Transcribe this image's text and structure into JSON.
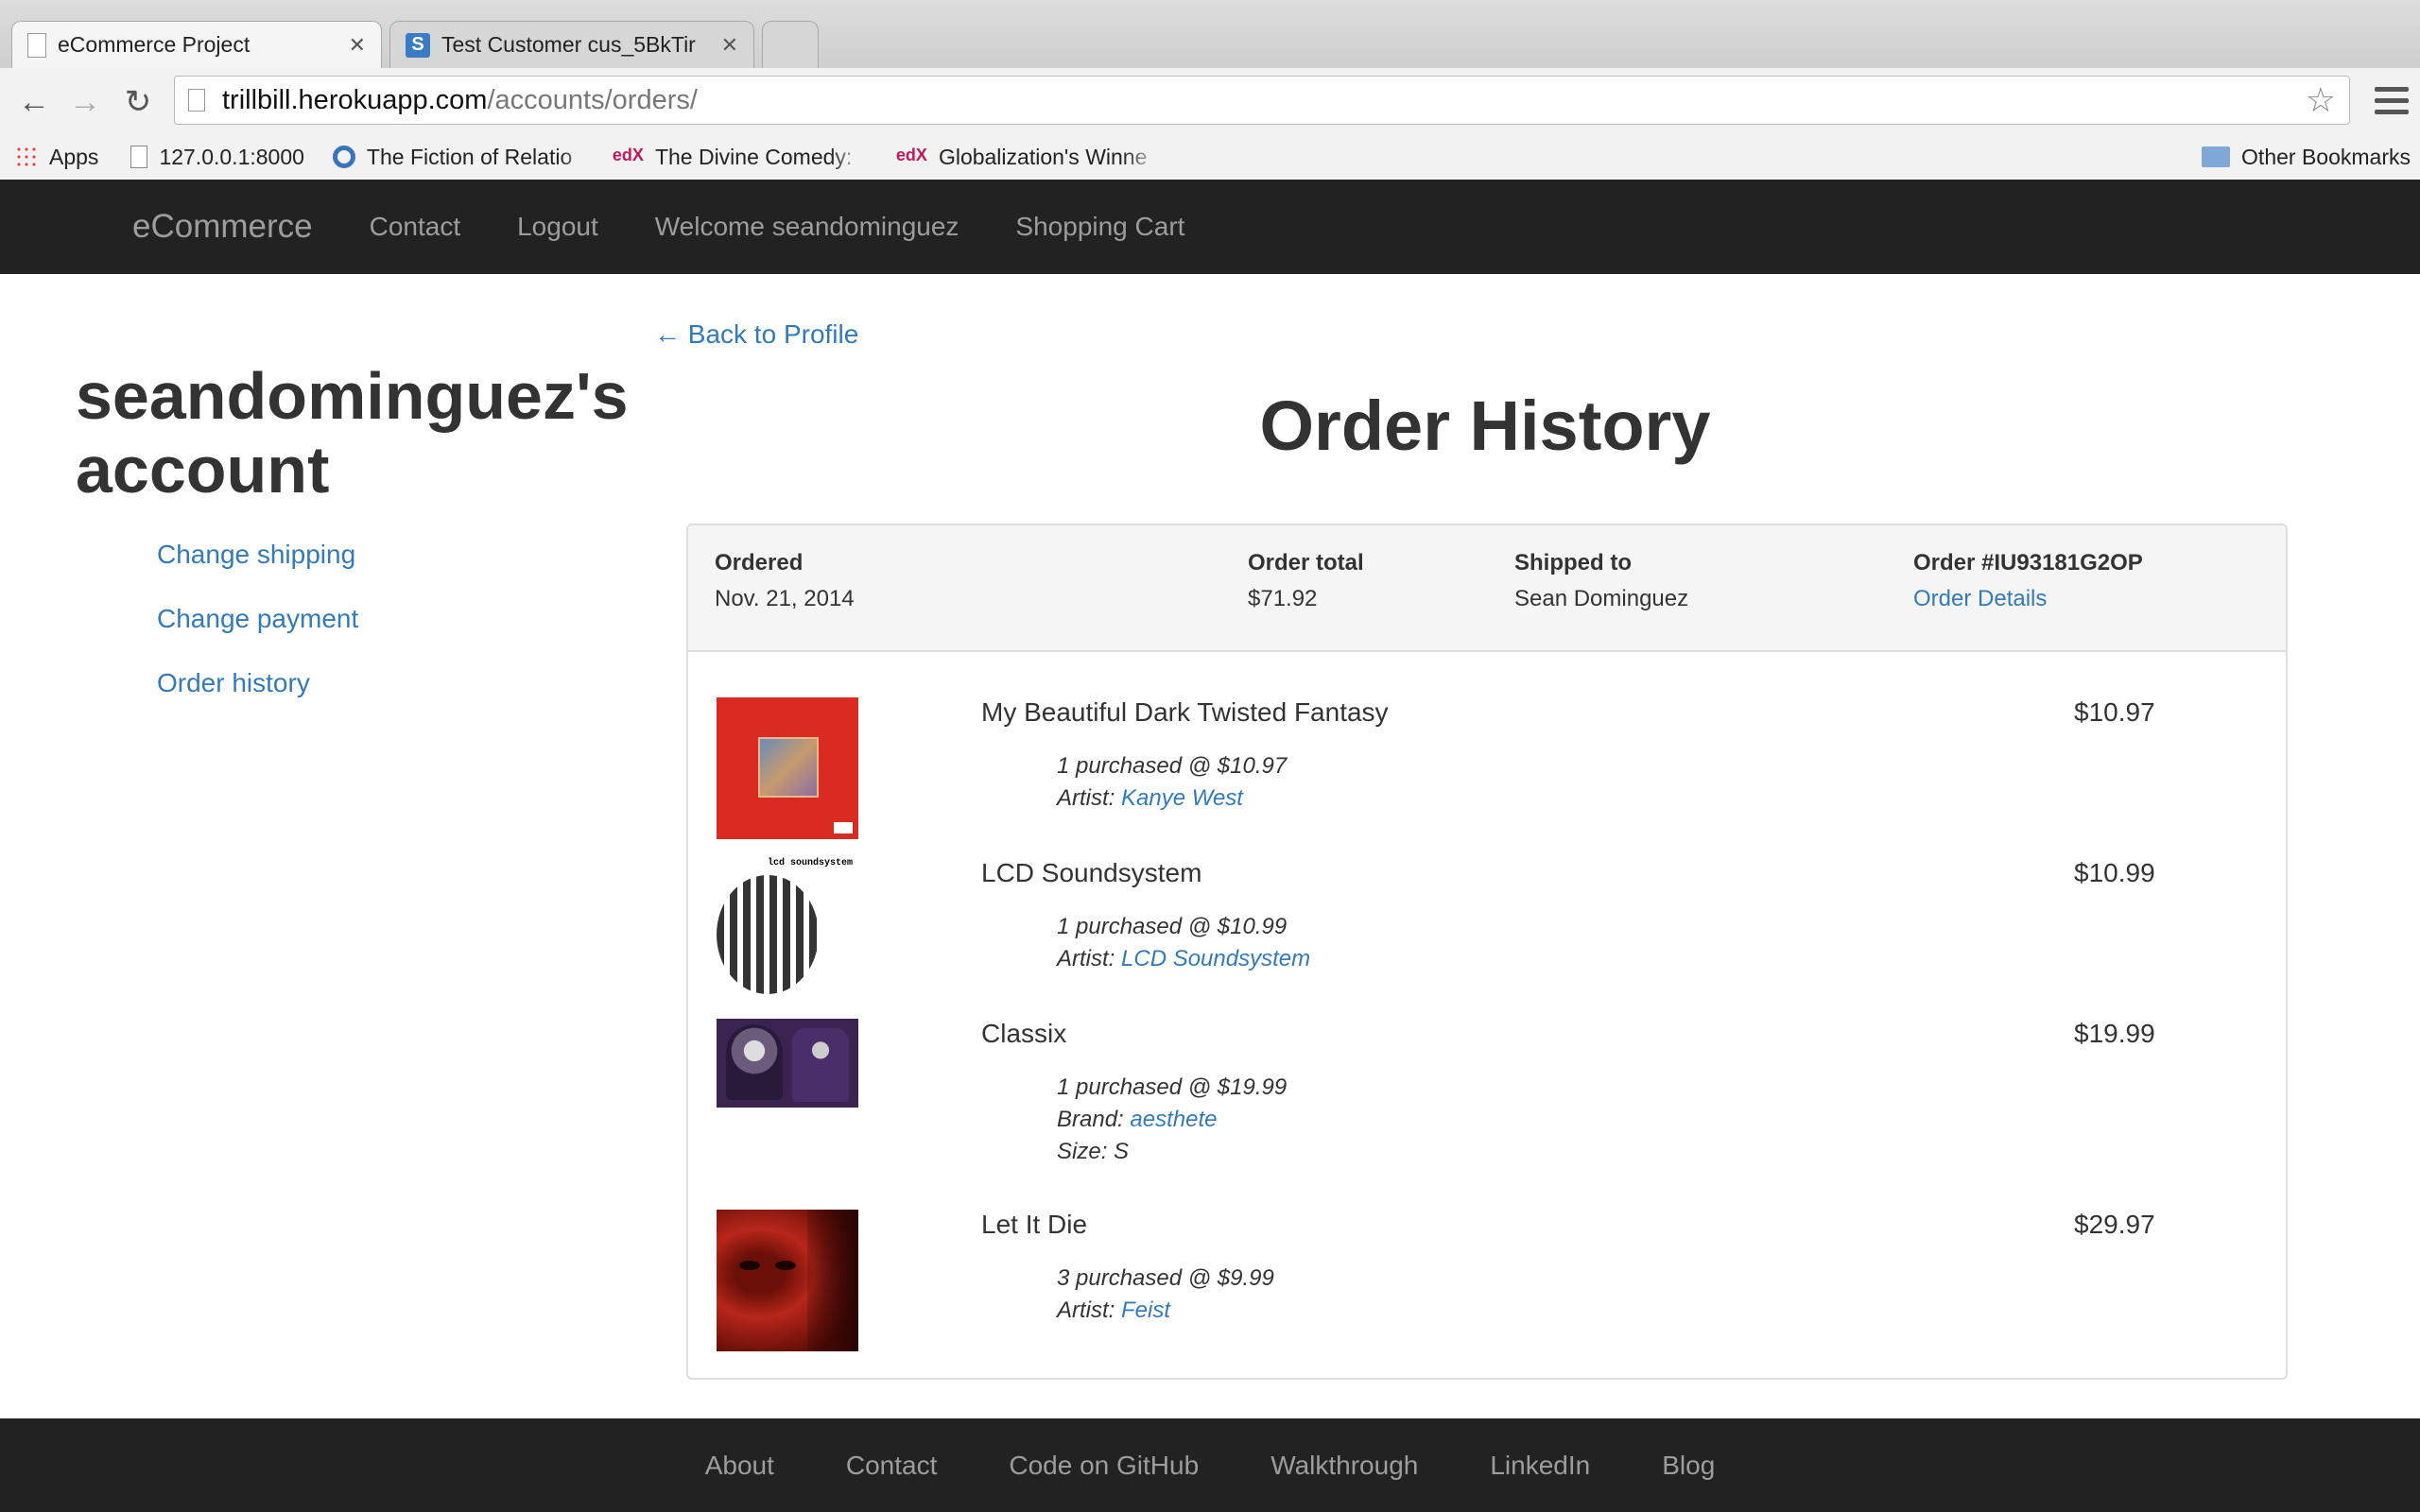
{
  "browser": {
    "tabs": [
      {
        "title": "eCommerce Project",
        "active": true
      },
      {
        "title": "Test Customer cus_5BkTir",
        "active": false
      }
    ],
    "url_host": "trillbill.herokuapp.com",
    "url_path": "/accounts/orders/",
    "bookmarks": [
      "Apps",
      "127.0.0.1:8000",
      "The Fiction of Relatio",
      "The Divine Comedy:",
      "Globalization's Winne"
    ],
    "other_bookmarks": "Other Bookmarks"
  },
  "nav": {
    "brand": "eCommerce",
    "links": [
      "Contact",
      "Logout",
      "Welcome seandominguez",
      "Shopping Cart"
    ]
  },
  "sidebar": {
    "title": "seandominguez's account",
    "links": [
      "Change shipping",
      "Change payment",
      "Order history"
    ]
  },
  "back_link": "← Back to Profile",
  "page_title": "Order History",
  "order": {
    "ordered_label": "Ordered",
    "ordered_value": "Nov. 21, 2014",
    "total_label": "Order total",
    "total_value": "$71.92",
    "shipped_label": "Shipped to",
    "shipped_value": "Sean Dominguez",
    "number_label": "Order #IU93181G2OP",
    "details_link": "Order Details"
  },
  "items": [
    {
      "name": "My Beautiful Dark Twisted Fantasy",
      "price": "$10.97",
      "qty_line": "1 purchased @ $10.97",
      "attr1_label": "Artist:",
      "attr1_value": "Kanye West"
    },
    {
      "name": "LCD Soundsystem",
      "price": "$10.99",
      "qty_line": "1 purchased @ $10.99",
      "attr1_label": "Artist:",
      "attr1_value": "LCD Soundsystem",
      "cover_text": "lcd soundsystem"
    },
    {
      "name": "Classix",
      "price": "$19.99",
      "qty_line": "1 purchased @ $19.99",
      "attr1_label": "Brand:",
      "attr1_value": "aesthete",
      "attr2": "Size: S"
    },
    {
      "name": "Let It Die",
      "price": "$29.97",
      "qty_line": "3 purchased @ $9.99",
      "attr1_label": "Artist:",
      "attr1_value": "Feist"
    }
  ],
  "footer": {
    "links": [
      "About",
      "Contact",
      "Code on GitHub",
      "Walkthrough",
      "LinkedIn",
      "Blog"
    ]
  }
}
